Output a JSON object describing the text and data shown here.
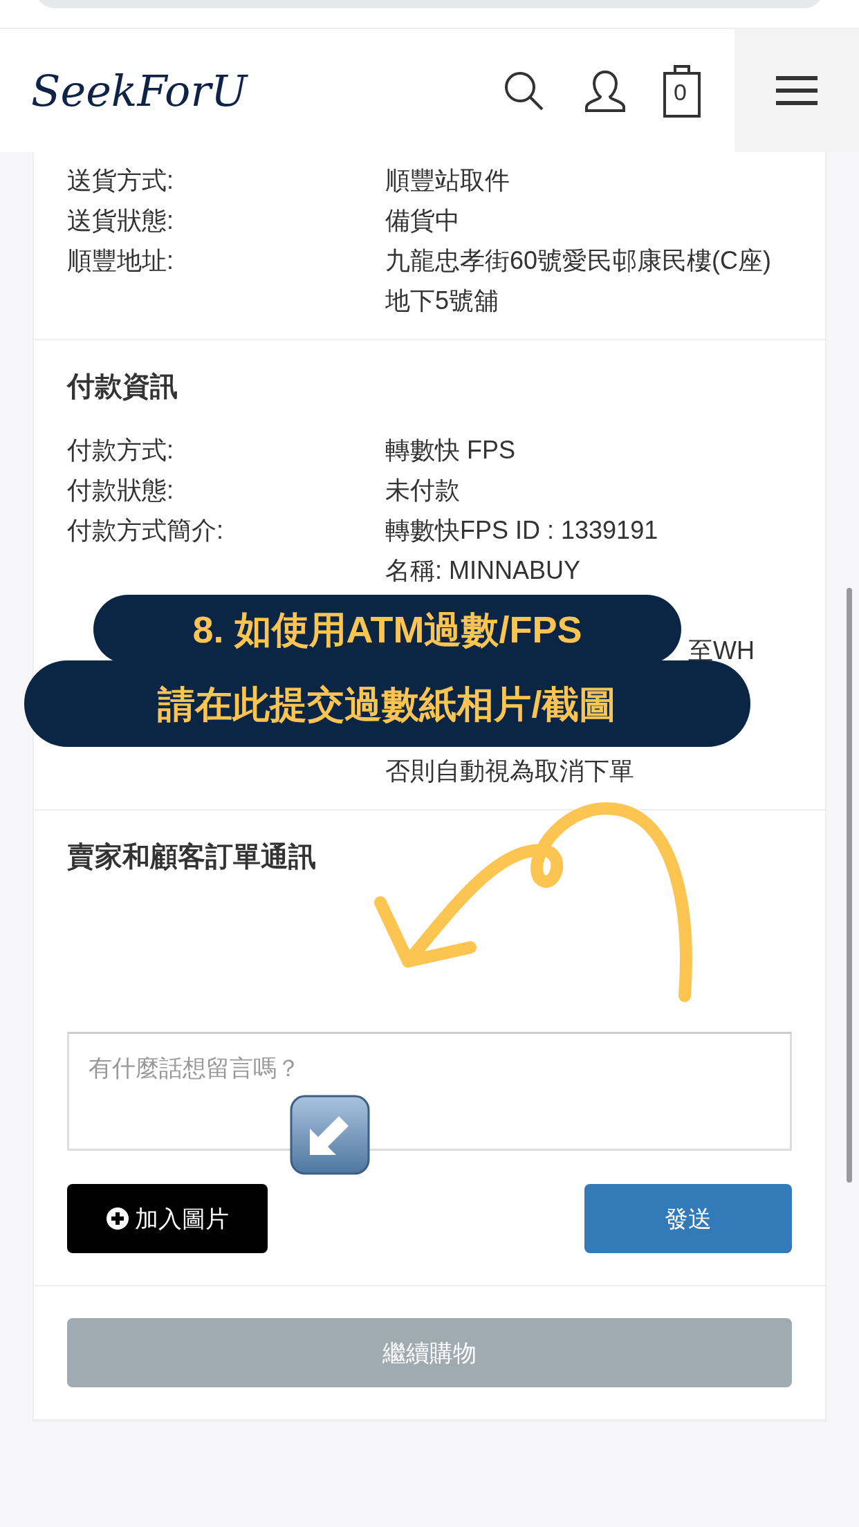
{
  "header": {
    "logo": "SeekForU",
    "cart_count": "0"
  },
  "shipping": {
    "rows": [
      {
        "label": "送貨方式:",
        "value": "順豐站取件"
      },
      {
        "label": "送貨狀態:",
        "value": "備貨中"
      },
      {
        "label": "順豐地址:",
        "value": "九龍忠孝街60號愛民邨康民樓(C座)地下5號舖"
      }
    ]
  },
  "payment": {
    "title": "付款資訊",
    "rows": [
      {
        "label": "付款方式:",
        "lines": [
          {
            "kind": "text",
            "text": "轉數快 FPS"
          }
        ]
      },
      {
        "label": "付款狀態:",
        "lines": [
          {
            "kind": "text",
            "text": "未付款"
          }
        ]
      },
      {
        "label": "付款方式簡介:",
        "lines": [
          {
            "kind": "text",
            "text": "轉數快FPS ID : 1339191"
          },
          {
            "kind": "text",
            "text": "名稱: MINNABUY"
          },
          {
            "kind": "covered"
          },
          {
            "kind": "tail",
            "text": "至WH"
          },
          {
            "kind": "covered"
          },
          {
            "kind": "covered"
          },
          {
            "kind": "text",
            "text": "否則自動視為取消下單"
          }
        ]
      }
    ]
  },
  "annotation": {
    "lines": [
      "8. 如使用ATM過數/FPS",
      "請在此提交過數紙相片/截圖"
    ]
  },
  "chat": {
    "title": "賣家和顧客訂單通訊",
    "placeholder": "有什麼話想留言嗎？",
    "add_image_button": "加入圖片",
    "send_button": "發送"
  },
  "continue_button": "繼續購物"
}
